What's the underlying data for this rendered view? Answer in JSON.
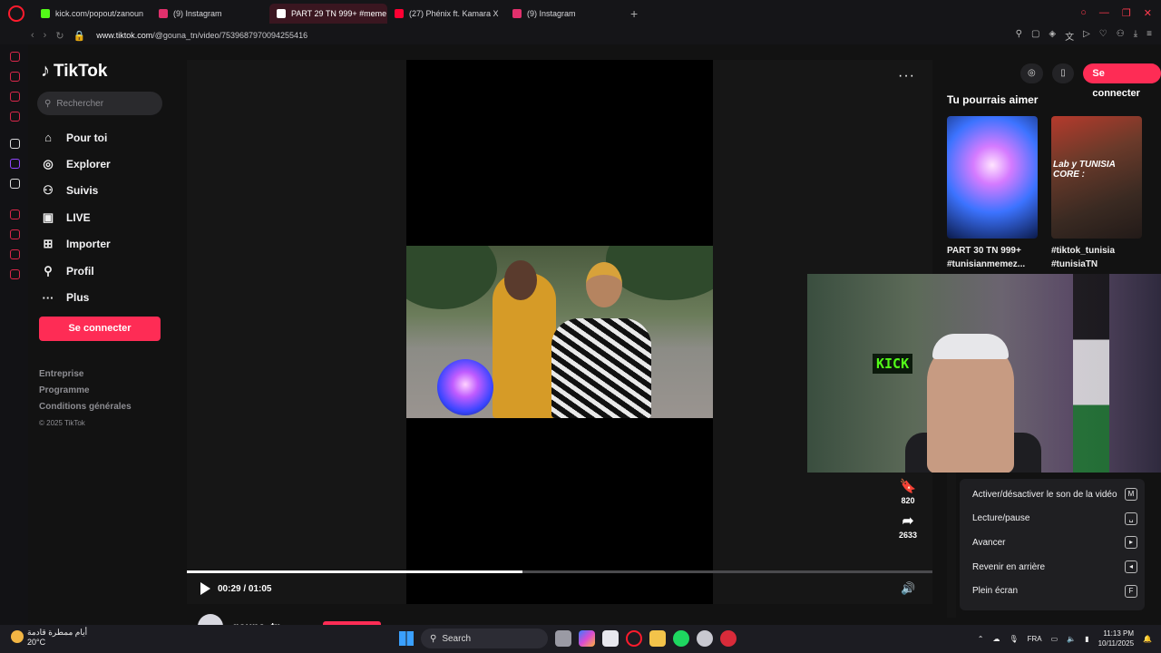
{
  "browser": {
    "tabs": [
      {
        "title": "kick.com/popout/zanoun",
        "favicon_color": "#53fc18"
      },
      {
        "title": "(9) Instagram",
        "favicon_color": "#e1306c"
      },
      {
        "title": "PART 29 TN 999+ #meme",
        "favicon_color": "#ffffff"
      },
      {
        "title": "(27) Phénix ft. Kamara X",
        "favicon_color": "#ff0033"
      },
      {
        "title": "(9) Instagram",
        "favicon_color": "#e1306c"
      }
    ],
    "new_tab": "+",
    "url_host": "www.tiktok.com",
    "url_path": "/@gouna_tn/video/7539687970094255416"
  },
  "tiktok": {
    "logo": "TikTok",
    "search_placeholder": "Rechercher",
    "menu": [
      {
        "label": "Pour toi",
        "icon": "⌂"
      },
      {
        "label": "Explorer",
        "icon": "◎"
      },
      {
        "label": "Suivis",
        "icon": "⚇"
      },
      {
        "label": "LIVE",
        "icon": "▣"
      },
      {
        "label": "Importer",
        "icon": "⊞"
      },
      {
        "label": "Profil",
        "icon": "⚲"
      },
      {
        "label": "Plus",
        "icon": "···"
      }
    ],
    "login_label": "Se connecter",
    "footer": [
      "Entreprise",
      "Programme",
      "Conditions générales"
    ],
    "copyright": "© 2025 TikTok",
    "player": {
      "time": "00:29 / 01:05",
      "progress_fraction": 0.45,
      "more_icon": "···"
    },
    "author": "gouna_tn",
    "actions": [
      {
        "icon": "bookmark-icon",
        "glyph": "🔖",
        "count": "820"
      },
      {
        "icon": "share-icon",
        "glyph": "➦",
        "count": "2633"
      }
    ],
    "top_right_login": "Se connecter",
    "suggest_title": "Tu pourrais aimer",
    "suggestions": [
      {
        "caption": "PART 30 TN 999+ #tunisianmemez..."
      },
      {
        "caption": "#tiktok_tunisia #tunisiaTN",
        "overlay": "Lab y TUNISIA CORE :"
      }
    ],
    "shortcuts": [
      {
        "label": "Activer/désactiver le son de la vidéo",
        "key": "M"
      },
      {
        "label": "Lecture/pause",
        "key": "␣"
      },
      {
        "label": "Avancer",
        "key": "▸"
      },
      {
        "label": "Revenir en arrière",
        "key": "◂"
      },
      {
        "label": "Plein écran",
        "key": "F"
      }
    ]
  },
  "webcam": {
    "sign": "KICK"
  },
  "taskbar": {
    "weather_text": "أيام ممطرة قادمة",
    "temperature": "20°C",
    "search_label": "Search",
    "language": "FRA",
    "time": "11:13 PM",
    "date": "10/11/2025"
  }
}
